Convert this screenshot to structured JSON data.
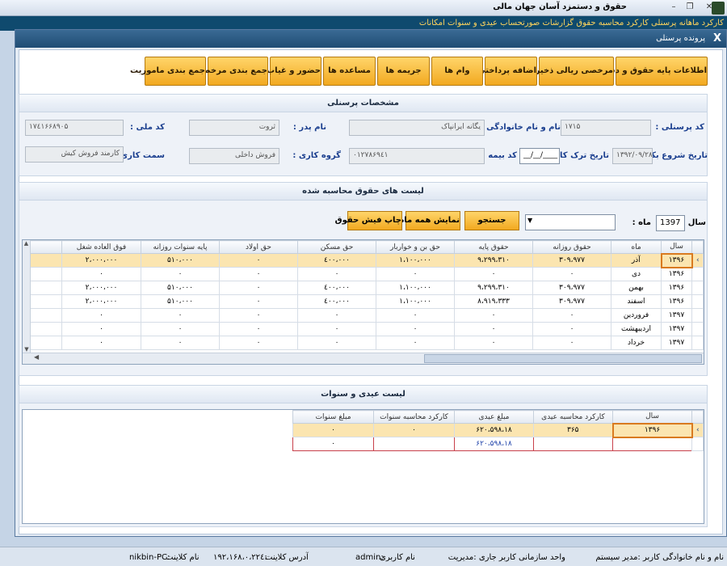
{
  "app": {
    "title": "حقوق و دستمزد آسان جهان مالی",
    "menu_text": "کارکرد ماهانه   پرسنلی   کارکرد   محاسبه حقوق   گزارشات   صورتحساب   عیدی و سنوات   امکانات",
    "controls": [
      "minimize-icon",
      "restore-icon",
      "close-icon"
    ]
  },
  "dialog": {
    "title": "پرونده پرسنلی",
    "close": "X"
  },
  "toolbar": {
    "buttons": [
      "اطلاعات پایه حقوق و دستمزد",
      "مرخصی ریالی ذخیره شده",
      "اضافه پرداختی",
      "وام ها",
      "جریمه ها",
      "مساعده ها",
      "حضور و غیاب",
      "جمع بندی مرخصی",
      "جمع بندی ماموریت"
    ]
  },
  "personnel": {
    "section_title": "مشخصات پرسنلی",
    "code_label": "کد پرسنلی :",
    "code_value": "١٧١۵",
    "name_label": "نام و نام خانوادگی :",
    "name_value": "یگانه ایرانپاک",
    "father_label": "نام پدر :",
    "father_value": "ثروت",
    "national_label": "کد ملی :",
    "national_value": "١٧٤١۶۶٨٩٠۵",
    "start_label": "تاریخ شروع بکار :",
    "start_value": "١٣٩٢/٠٩/٢٨",
    "leave_label": "تاریخ ترک کار :",
    "leave_value": "__/__/____",
    "insurance_label": "کد بیمه :",
    "insurance_value": "٠١٢٧٨۶٩٤١",
    "group_label": "گروه کاری :",
    "group_value": "فروش داخلی",
    "post_label": "سمت کاری :",
    "post_value": "کارمند فروش کیش"
  },
  "salary": {
    "section_title": "لیست های حقوق محاسبه شده",
    "year_label": "سال :",
    "year_value": "1397",
    "month_label": "ماه :",
    "month_value": "",
    "search_btn": "جستجو",
    "show_all_btn": "نمایش همه ماه ها",
    "print_btn": "چاپ فیش حقوق",
    "columns": [
      "سال",
      "ماه",
      "حقوق روزانه",
      "حقوق پایه",
      "حق بن و خواربار",
      "حق مسکن",
      "حق اولاد",
      "پایه سنوات روزانه",
      "فوق العاده شغل"
    ],
    "rows": [
      [
        "١٣٩۶",
        "آذر",
        "٣٠٩،٩٧٧",
        "٩،٢٩٩،٣١٠",
        "١،١٠٠،٠٠٠",
        "٤٠٠،٠٠٠",
        "٠",
        "۵١٠،٠٠٠",
        "٢،٠٠٠،٠٠٠"
      ],
      [
        "١٣٩۶",
        "دی",
        "٠",
        "٠",
        "٠",
        "٠",
        "٠",
        "٠",
        "٠"
      ],
      [
        "١٣٩۶",
        "بهمن",
        "٣٠٩،٩٧٧",
        "٩،٢٩٩،٣١٠",
        "١،١٠٠،٠٠٠",
        "٤٠٠،٠٠٠",
        "٠",
        "۵١٠،٠٠٠",
        "٢،٠٠٠،٠٠٠"
      ],
      [
        "١٣٩۶",
        "اسفند",
        "٣٠٩،٩٧٧",
        "٨،٩١٩،٣٣٣",
        "١،١٠٠،٠٠٠",
        "٤٠٠،٠٠٠",
        "٠",
        "۵١٠،٠٠٠",
        "٢،٠٠٠،٠٠٠"
      ],
      [
        "١٣٩٧",
        "فروردین",
        "٠",
        "٠",
        "٠",
        "٠",
        "٠",
        "٠",
        "٠"
      ],
      [
        "١٣٩٧",
        "اردیبهشت",
        "٠",
        "٠",
        "٠",
        "٠",
        "٠",
        "٠",
        "٠"
      ],
      [
        "١٣٩٧",
        "خرداد",
        "٠",
        "٠",
        "٠",
        "٠",
        "٠",
        "٠",
        "٠"
      ]
    ]
  },
  "bonus": {
    "section_title": "لیست عیدی و سنوات",
    "columns": [
      "سال",
      "کارکرد محاسبه عیدی",
      "مبلغ عیدی",
      "کارکرد محاسبه سنوات",
      "مبلغ سنوات"
    ],
    "rows": [
      [
        "١٣٩۶",
        "٣۶۵",
        "١٨،۵٩٨،۶٢٠",
        "٠",
        "٠"
      ]
    ],
    "summary": [
      "",
      "",
      "١٨،۵٩٨،۶٢٠",
      "",
      "٠"
    ]
  },
  "status": {
    "fullname": "نام و نام خانوادگی کاربر :مدیر سیستم",
    "unit": "واحد سازمانی کاربر جاری :مدیریت",
    "username_label": "نام کاربری",
    "username_value": "admin:",
    "address_label": "آدرس کلاینت",
    "address_value": "١٩٢،١۶٨،٠،٢٢٤:",
    "client_label": "نام کلاینت",
    "client_value": "nikbin-PC:"
  },
  "colors": {
    "accent_button": "#f2a920",
    "selected_row": "#fbe5b0",
    "dialog_title": "#1f4c74",
    "label_blue": "#1b3f8f"
  }
}
